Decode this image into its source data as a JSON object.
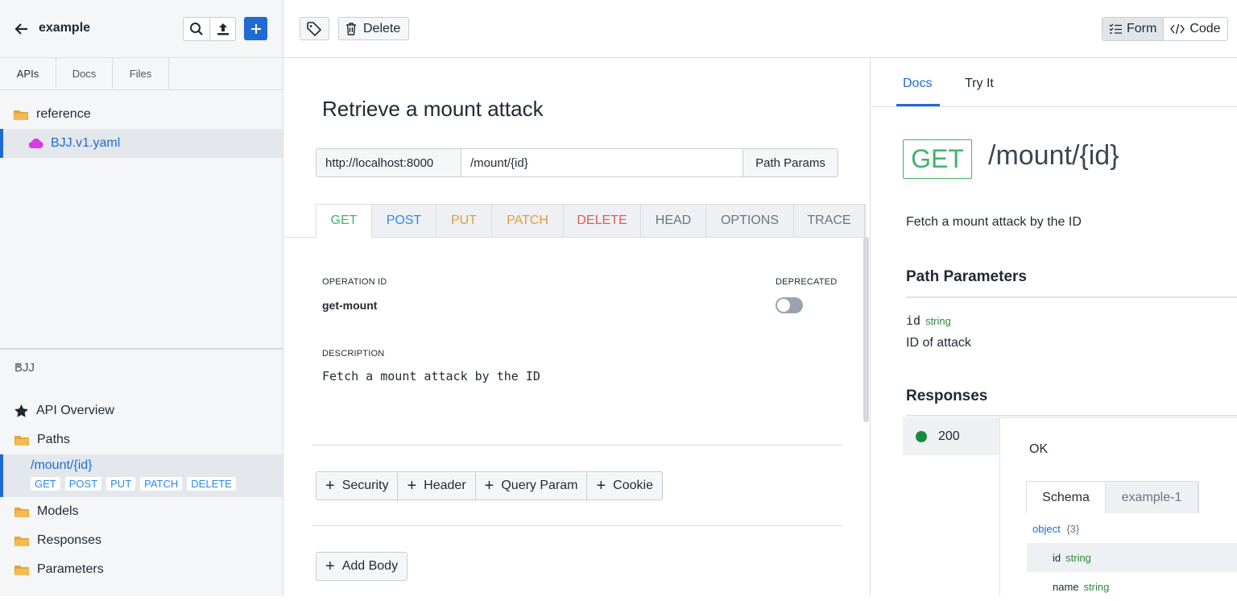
{
  "sidebar": {
    "project_name": "example",
    "tabs": [
      "APIs",
      "Docs",
      "Files"
    ],
    "tree": [
      {
        "label": "reference",
        "icon": "folder-icon"
      },
      {
        "label": "BJJ.v1.yaml",
        "icon": "cloud-icon"
      }
    ],
    "outline": {
      "title": "BJJ",
      "close": "×",
      "items": {
        "overview": "API Overview",
        "paths": "Paths",
        "path": "/mount/{id}",
        "methods": [
          "GET",
          "POST",
          "PUT",
          "PATCH",
          "DELETE"
        ],
        "models": "Models",
        "responses": "Responses",
        "parameters": "Parameters"
      }
    }
  },
  "toolbar": {
    "delete_label": "Delete",
    "form_label": "Form",
    "code_label": "Code"
  },
  "editor": {
    "title": "Retrieve a mount attack",
    "url_host": "http://localhost:8000",
    "url_path": "/mount/{id}",
    "path_params_label": "Path Params",
    "method_tabs": [
      {
        "label": "GET",
        "color": "#3fb46a"
      },
      {
        "label": "POST",
        "color": "#2d8ae8"
      },
      {
        "label": "PUT",
        "color": "#e89a3c"
      },
      {
        "label": "PATCH",
        "color": "#e89a3c"
      },
      {
        "label": "DELETE",
        "color": "#e05a5a"
      },
      {
        "label": "HEAD",
        "color": "#6b7580"
      },
      {
        "label": "OPTIONS",
        "color": "#6b7580"
      },
      {
        "label": "TRACE",
        "color": "#6b7580"
      }
    ],
    "operation_id_label": "OPERATION ID",
    "operation_id": "get-mount",
    "deprecated_label": "DEPRECATED",
    "deprecated": false,
    "description_label": "DESCRIPTION",
    "description": "Fetch a mount attack by the ID",
    "add_buttons": [
      "Security",
      "Header",
      "Query Param",
      "Cookie"
    ],
    "add_body_label": "Add Body"
  },
  "docs": {
    "tabs": [
      "Docs",
      "Try It"
    ],
    "method": "GET",
    "path": "/mount/{id}",
    "summary": "Fetch a mount attack by the ID",
    "path_params_heading": "Path Parameters",
    "param_name": "id",
    "param_type": "string",
    "param_desc": "ID of attack",
    "responses_heading": "Responses",
    "response_code": "200",
    "response_desc": "OK",
    "schema_tabs": [
      "Schema",
      "example-1"
    ],
    "schema_type": "object",
    "schema_count": "{3}",
    "fields": [
      {
        "name": "id",
        "type": "string"
      },
      {
        "name": "name",
        "type": "string"
      }
    ]
  }
}
